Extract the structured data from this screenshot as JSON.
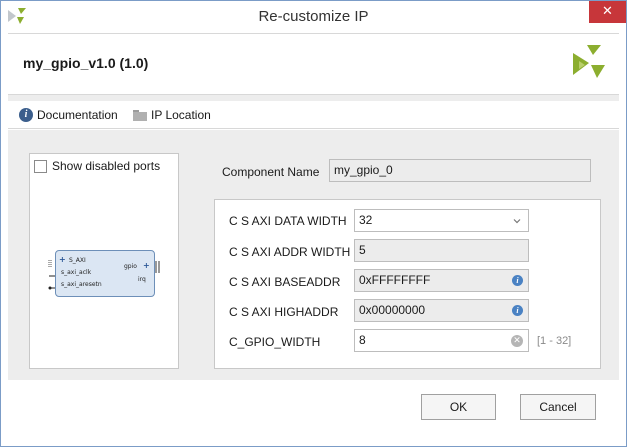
{
  "window": {
    "title": "Re-customize IP",
    "close_glyph": "✕"
  },
  "header": {
    "ip_name": "my_gpio_v1.0 (1.0)",
    "logo_icon": "vivado-logo-icon"
  },
  "toolbar": {
    "documentation_label": "Documentation",
    "ip_location_label": "IP Location",
    "info_glyph": "i"
  },
  "left_panel": {
    "show_disabled_ports_label": "Show disabled ports",
    "show_disabled_ports_checked": false,
    "symbol": {
      "s_axi": "S_AXI",
      "s_axi_aclk": "s_axi_aclk",
      "s_axi_aresetn": "s_axi_aresetn",
      "gpio": "gpio",
      "irq": "irq"
    }
  },
  "component": {
    "label": "Component Name",
    "value": "my_gpio_0"
  },
  "params": [
    {
      "label": "C S AXI DATA WIDTH",
      "value": "32",
      "kind": "dropdown"
    },
    {
      "label": "C S AXI ADDR WIDTH",
      "value": "5",
      "kind": "readonly"
    },
    {
      "label": "C S AXI BASEADDR",
      "value": "0xFFFFFFFF",
      "kind": "info"
    },
    {
      "label": "C S AXI HIGHADDR",
      "value": "0x00000000",
      "kind": "info"
    },
    {
      "label": "C_GPIO_WIDTH",
      "value": "8",
      "kind": "clearable",
      "range": "[1 - 32]"
    }
  ],
  "buttons": {
    "ok": "OK",
    "cancel": "Cancel"
  },
  "colors": {
    "close_red": "#c7363a",
    "info_blue": "#4a82c3",
    "logo_green": "#8cae2f"
  }
}
